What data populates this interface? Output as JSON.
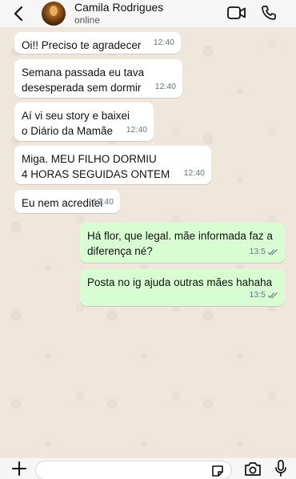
{
  "header": {
    "contact_name": "Camila Rodrigues",
    "status": "online"
  },
  "messages": [
    {
      "direction": "in",
      "text": "Oi!! Preciso te agradecer",
      "time": "12:40"
    },
    {
      "direction": "in",
      "text": "Semana passada eu tava\ndesesperada sem dormir",
      "time": "12:40"
    },
    {
      "direction": "in",
      "text": "Aí vi seu story e baixei\no Diário da Mamãe",
      "time": "12:40"
    },
    {
      "direction": "in",
      "text": "Miga. MEU FILHO DORMIU\n4 HORAS SEGUIDAS ONTEM",
      "time": "12:40"
    },
    {
      "direction": "in",
      "text": "Eu nem acreditei",
      "time": "12:40"
    },
    {
      "direction": "out",
      "text": "Há flor, que legal. mãe informada faz a\ndiferença né?",
      "time": "13:5",
      "read": true
    },
    {
      "direction": "out",
      "text": "Posta no ig ajuda outras mães hahaha",
      "time": "13:5",
      "read": true
    }
  ],
  "input": {
    "placeholder": ""
  },
  "colors": {
    "incoming": "#ffffff",
    "outgoing": "#d9fdd3",
    "chat_bg": "#efe7dc",
    "read_ticks": "#667781"
  },
  "icons": [
    "back-arrow-icon",
    "avatar",
    "video-call-icon",
    "phone-icon",
    "plus-icon",
    "sticker-icon",
    "camera-icon",
    "microphone-icon",
    "double-check-icon"
  ]
}
